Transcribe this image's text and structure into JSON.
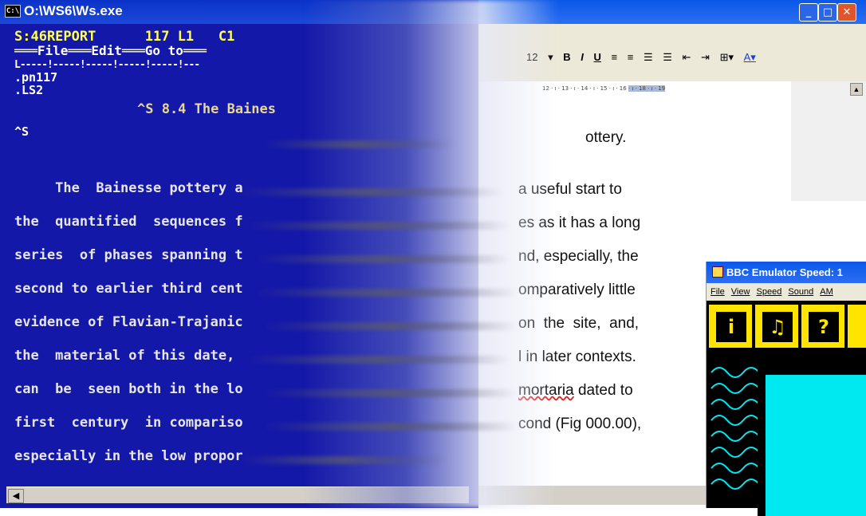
{
  "dos": {
    "title": "O:\\WS6\\Ws.exe",
    "title_icon": "C:\\",
    "status": "S:46REPORT      117 L1   C1",
    "menu": "═══File═══Edit═══Go to═══",
    "ruler": "L-----!-----!-----!-----!-----!---",
    "dot_pn": ".pn117",
    "dot_ls": ".LS2",
    "heading": "^S 8.4 The Baines",
    "caret_s": "^S",
    "lines": [
      "     The  Bainesse pottery a",
      "the  quantified  sequences f",
      "series  of phases spanning t",
      "second to earlier third cent",
      "evidence of Flavian-Trajanic",
      "the  material of this date, ",
      "can  be  seen both in the lo",
      "first  century  in compariso",
      "especially in the low propor"
    ]
  },
  "word": {
    "font_size": "12",
    "toolbar_bold": "B",
    "toolbar_italic": "I",
    "toolbar_underline": "U",
    "ruler_text": "12 · ı · 13 · ı · 14 · ı · 15 · ı · 16",
    "ruler_hl": "· ı · 18 · ı · 19",
    "heading_tail": "ottery.",
    "lines": [
      "a useful start to",
      "es as it has a long",
      "nd, especially, the",
      "omparatively little",
      "on  the  site,  and,",
      "l in later contexts.",
      "mortaria dated to",
      "cond (Fig 000.00),"
    ],
    "misspelt_word": "mortaria"
  },
  "bbc": {
    "title": "BBC Emulator  Speed: 1",
    "menu": [
      "File",
      "View",
      "Speed",
      "Sound",
      "AM"
    ],
    "icons": [
      "i",
      "♫",
      "?"
    ]
  },
  "colors": {
    "dos_bg": "#1418a8",
    "titlebar": "#0a58e8",
    "bbc_yellow": "#ffe400",
    "bbc_cyan": "#00e8f0"
  }
}
